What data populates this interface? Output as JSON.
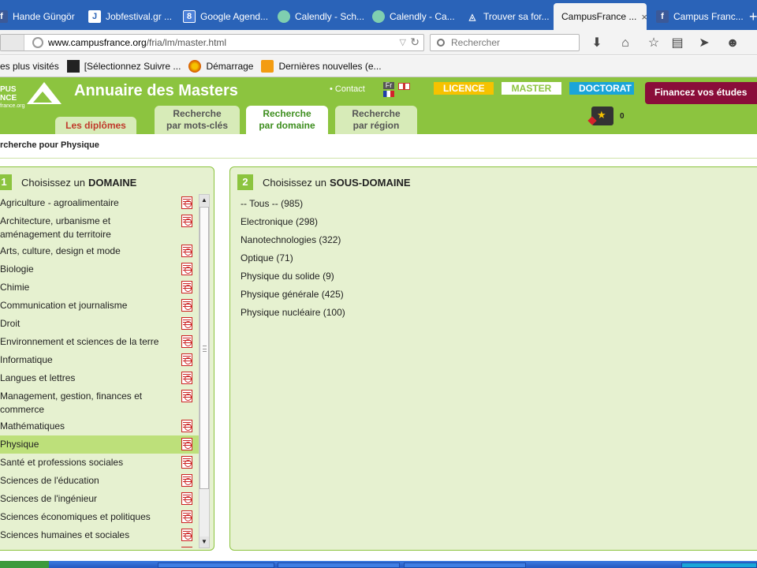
{
  "browser": {
    "tabs": [
      {
        "label": "Hande Güngör",
        "icon": "facebook-icon"
      },
      {
        "label": "Jobfestival.gr ...",
        "icon": "jobfestival-icon"
      },
      {
        "label": "Google Agend...",
        "icon": "google-icon"
      },
      {
        "label": "Calendly - Sch...",
        "icon": "calendly-icon"
      },
      {
        "label": "Calendly - Ca...",
        "icon": "calendly-icon"
      },
      {
        "label": "Trouver sa for...",
        "icon": "campusfrance-icon"
      },
      {
        "label": "CampusFrance ...",
        "icon": "campusfrance-icon",
        "active": true
      },
      {
        "label": "Campus Franc...",
        "icon": "facebook-icon"
      }
    ],
    "new_tab": "+",
    "close_glyph": "×",
    "url_host": "www.campusfrance.org",
    "url_path": "/fria/lm/master.html",
    "search_placeholder": "Rechercher",
    "bookmarks": [
      {
        "label": "es plus visités"
      },
      {
        "label": "[Sélectionnez Suivre ...",
        "icon": "cned-icon"
      },
      {
        "label": "Démarrage",
        "icon": "firefox-icon"
      },
      {
        "label": "Dernières nouvelles (e...",
        "icon": "rss-icon"
      }
    ]
  },
  "site": {
    "logo_text_1": "PUS",
    "logo_text_2": "NCE",
    "logo_text_3": "france.org",
    "title": "Annuaire des Masters",
    "contact": "• Contact",
    "lang_fr": "Fr",
    "levels": {
      "licence": "LICENCE",
      "master": "MASTER",
      "doctorat": "DOCTORAT"
    },
    "financez": "Financez vos études",
    "tabs": {
      "diplomes": "Les diplômes",
      "motscles_1": "Recherche",
      "motscles_2": "par mots-clés",
      "domaine_1": "Recherche",
      "domaine_2": "par domaine",
      "region_1": "Recherche",
      "region_2": "par région"
    },
    "cart_count": "0",
    "breadcrumb": "rcherche pour Physique"
  },
  "panel_domaine": {
    "num": "1",
    "title_prefix": "Choisissez un",
    "title_strong": "DOMAINE",
    "items": [
      "Agriculture - agroalimentaire",
      "Architecture, urbanisme et aménagement du territoire",
      "Arts, culture, design et mode",
      "Biologie",
      "Chimie",
      "Communication et journalisme",
      "Droit",
      "Environnement et sciences de la terre",
      "Informatique",
      "Langues et lettres",
      "Management, gestion, finances et commerce",
      "Mathématiques",
      "Physique",
      "Santé et professions sociales",
      "Sciences de l'éducation",
      "Sciences de l'ingénieur",
      "Sciences économiques et politiques",
      "Sciences humaines et sociales"
    ],
    "selected": "Physique"
  },
  "panel_sous": {
    "num": "2",
    "title_prefix": "Choisissez un",
    "title_strong": "SOUS-DOMAINE",
    "items": [
      "-- Tous -- (985)",
      "Electronique (298)",
      "Nanotechnologies (322)",
      "Optique (71)",
      "Physique du solide (9)",
      "Physique générale (425)",
      "Physique nucléaire (100)"
    ]
  }
}
